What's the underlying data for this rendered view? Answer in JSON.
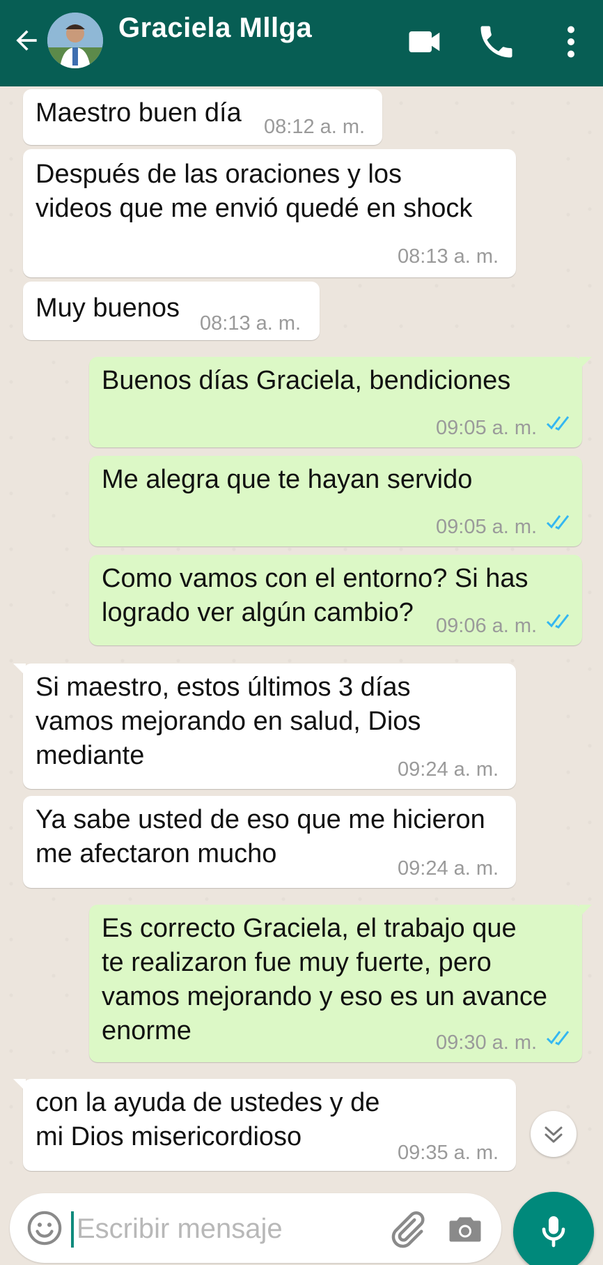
{
  "header": {
    "contact_name": "Graciela Mllga",
    "icons": [
      "back-arrow",
      "video-call",
      "voice-call",
      "more-options"
    ]
  },
  "messages": [
    {
      "direction": "incoming",
      "text": "Maestro buen día",
      "time": "08:12 a. m."
    },
    {
      "direction": "incoming",
      "text": "Después de las oraciones y los\nvideos que me envió quedé en shock",
      "time": "08:13 a. m."
    },
    {
      "direction": "incoming",
      "text": "Muy buenos",
      "time": "08:13 a. m."
    },
    {
      "direction": "outgoing",
      "text": "Buenos días Graciela, bendiciones",
      "time": "09:05 a. m.",
      "status": "read"
    },
    {
      "direction": "outgoing",
      "text": "Me alegra que te hayan servido",
      "time": "09:05 a. m.",
      "status": "read"
    },
    {
      "direction": "outgoing",
      "text": "Como vamos con el entorno? Si has\nlogrado ver algún cambio?",
      "time": "09:06 a. m.",
      "status": "read"
    },
    {
      "direction": "incoming",
      "text": "Si maestro, estos últimos 3 días\nvamos mejorando en salud, Dios\nmediante",
      "time": "09:24 a. m."
    },
    {
      "direction": "incoming",
      "text": "Ya sabe usted de eso que me hicieron\nme afectaron mucho",
      "time": "09:24 a. m."
    },
    {
      "direction": "outgoing",
      "text": "Es correcto Graciela, el trabajo que\nte realizaron fue muy fuerte, pero\nvamos mejorando y eso es un avance\nenorme",
      "time": "09:30 a. m.",
      "status": "read"
    },
    {
      "direction": "incoming",
      "text": "con la ayuda de ustedes y de\nmi Dios misericordioso",
      "time": "09:35 a. m."
    }
  ],
  "composer": {
    "placeholder": "Escribir mensaje",
    "icons": [
      "emoji",
      "attach",
      "camera",
      "microphone"
    ]
  },
  "colors": {
    "header": "#075e54",
    "chat_background": "#ece5dd",
    "incoming_bubble": "#ffffff",
    "outgoing_bubble": "#dcf8c6",
    "read_ticks": "#34b7f1",
    "mic_button": "#00897b"
  }
}
